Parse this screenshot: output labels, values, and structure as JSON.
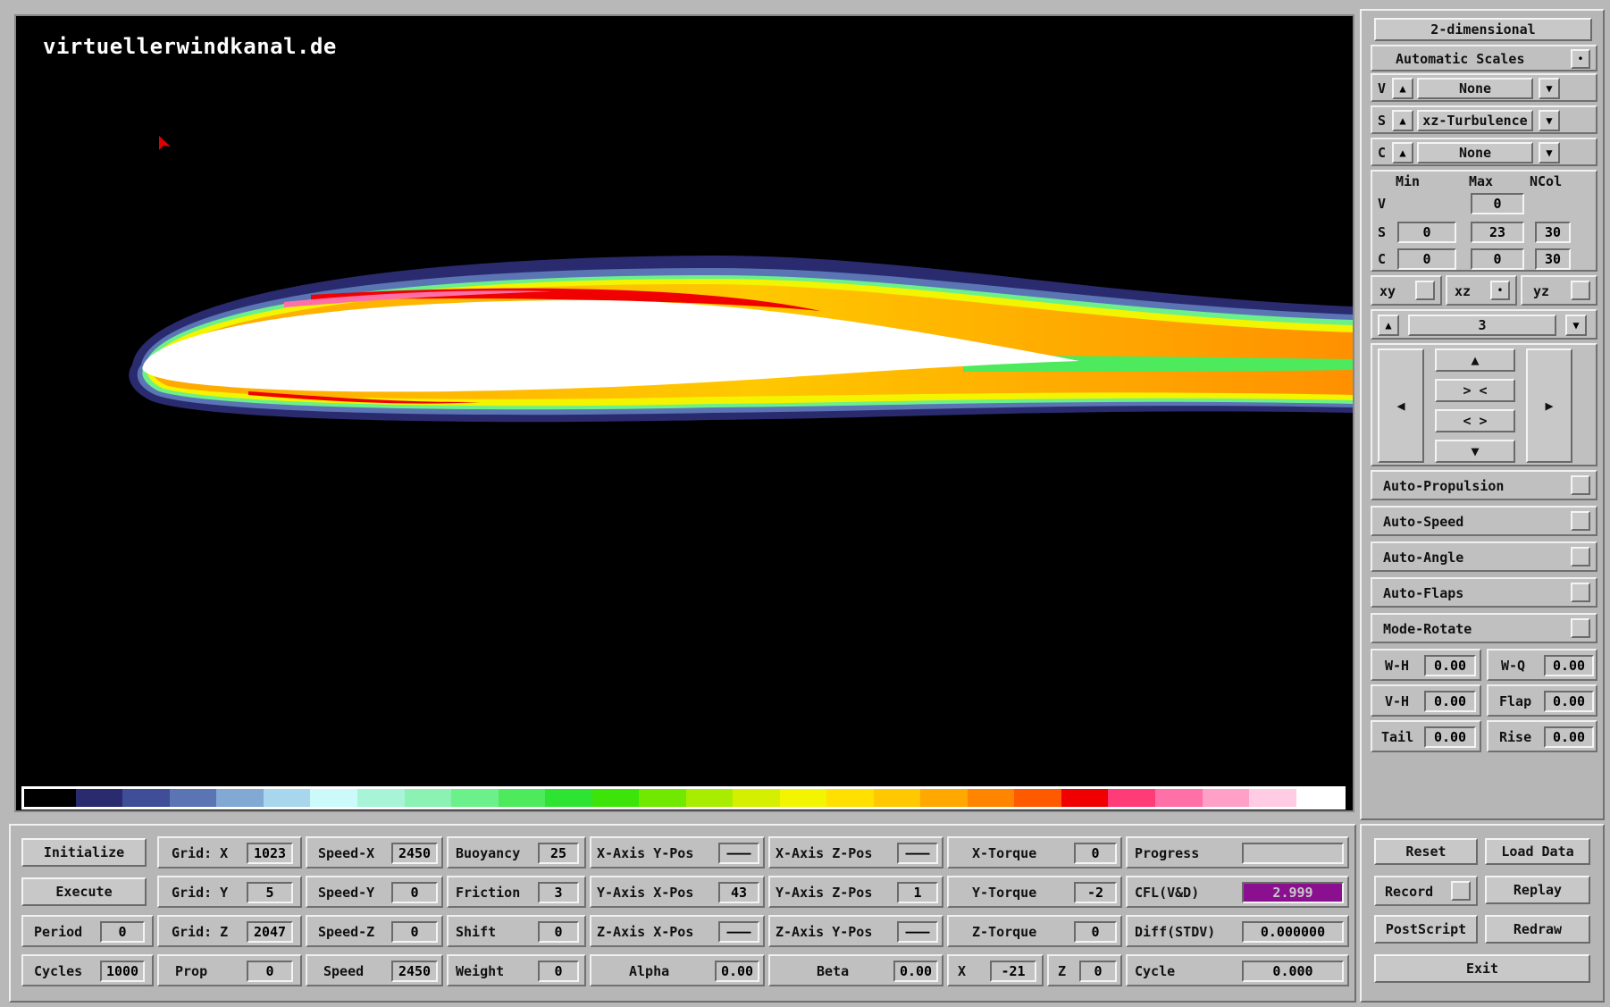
{
  "brand": "virtuellerwindkanal.de",
  "colorbar": [
    "#000000",
    "#2a2a6e",
    "#404e98",
    "#5a74b4",
    "#82a8d4",
    "#a8d6ec",
    "#ccfafa",
    "#a8f4d8",
    "#8cf2b4",
    "#6cf08a",
    "#4cea5c",
    "#2ee432",
    "#3ce40a",
    "#70e800",
    "#a8ec00",
    "#d4f000",
    "#f2f400",
    "#ffe000",
    "#ffc800",
    "#ffa800",
    "#ff8400",
    "#ff5a00",
    "#f00000",
    "#ff3c78",
    "#ff70a8",
    "#ffa0c8",
    "#ffcce4",
    "#ffffff"
  ],
  "right": {
    "mode": "2-dimensional",
    "auto_scales": "Automatic Scales",
    "auto_scales_check": "•",
    "v_label": "V",
    "v_value": "None",
    "s_label": "S",
    "s_value": "xz-Turbulence",
    "c_label": "C",
    "c_value": "None",
    "hdr_min": "Min",
    "hdr_max": "Max",
    "hdr_ncol": "NCol",
    "row_v": "V",
    "v_max": "0",
    "row_s": "S",
    "s_min": "0",
    "s_max": "23",
    "s_ncol": "30",
    "row_c": "C",
    "c_min": "0",
    "c_max": "0",
    "c_ncol": "30",
    "plane_xy": "xy",
    "plane_xz": "xz",
    "plane_yz": "yz",
    "plane_xz_check": "•",
    "layer": "3",
    "nav_up": "▲",
    "nav_in": "> <",
    "nav_out": "< >",
    "nav_down": "▼",
    "nav_left": "◀",
    "nav_right": "▶",
    "toggles": [
      "Auto-Propulsion",
      "Auto-Speed",
      "Auto-Angle",
      "Auto-Flaps",
      "Mode-Rotate"
    ],
    "wh": "W-H",
    "wh_v": "0.00",
    "wq": "W-Q",
    "wq_v": "0.00",
    "vh": "V-H",
    "vh_v": "0.00",
    "flap": "Flap",
    "flap_v": "0.00",
    "tail": "Tail",
    "tail_v": "0.00",
    "rise": "Rise",
    "rise_v": "0.00"
  },
  "bottom": {
    "initialize": "Initialize",
    "execute": "Execute",
    "period": "Period",
    "period_v": "0",
    "cycles": "Cycles",
    "cycles_v": "1000",
    "gridx": "Grid: X",
    "gridx_v": "1023",
    "gridy": "Grid: Y",
    "gridy_v": "5",
    "gridz": "Grid: Z",
    "gridz_v": "2047",
    "prop": "Prop",
    "prop_v": "0",
    "speedx": "Speed-X",
    "speedx_v": "2450",
    "speedy": "Speed-Y",
    "speedy_v": "0",
    "speedz": "Speed-Z",
    "speedz_v": "0",
    "speed": "Speed",
    "speed_v": "2450",
    "buoyancy": "Buoyancy",
    "buoyancy_v": "25",
    "friction": "Friction",
    "friction_v": "3",
    "shift": "Shift",
    "shift_v": "0",
    "weight": "Weight",
    "weight_v": "0",
    "xaxis_ypos": "X-Axis Y-Pos",
    "xaxis_ypos_v": "———",
    "yaxis_xpos": "Y-Axis X-Pos",
    "yaxis_xpos_v": "43",
    "zaxis_xpos": "Z-Axis X-Pos",
    "zaxis_xpos_v": "———",
    "alpha": "Alpha",
    "alpha_v": "0.00",
    "xaxis_zpos": "X-Axis Z-Pos",
    "xaxis_zpos_v": "———",
    "yaxis_zpos": "Y-Axis Z-Pos",
    "yaxis_zpos_v": "1",
    "zaxis_ypos": "Z-Axis Y-Pos",
    "zaxis_ypos_v": "———",
    "beta": "Beta",
    "beta_v": "0.00",
    "xtorque": "X-Torque",
    "xtorque_v": "0",
    "ytorque": "Y-Torque",
    "ytorque_v": "-2",
    "ztorque": "Z-Torque",
    "ztorque_v": "0",
    "x_lbl": "X",
    "x_v": "-21",
    "z_lbl": "Z",
    "z_v": "0",
    "progress": "Progress",
    "progress_fraction": 0.0,
    "cfl": "CFL(V&D)",
    "cfl_v": "2.999",
    "cfl_color": "#8a1090",
    "diff": "Diff(STDV)",
    "diff_v": "0.000000",
    "cycle": "Cycle",
    "cycle_v": "0.000"
  },
  "actions": {
    "reset": "Reset",
    "load": "Load Data",
    "record": "Record",
    "replay": "Replay",
    "postscript": "PostScript",
    "redraw": "Redraw",
    "exit": "Exit"
  }
}
